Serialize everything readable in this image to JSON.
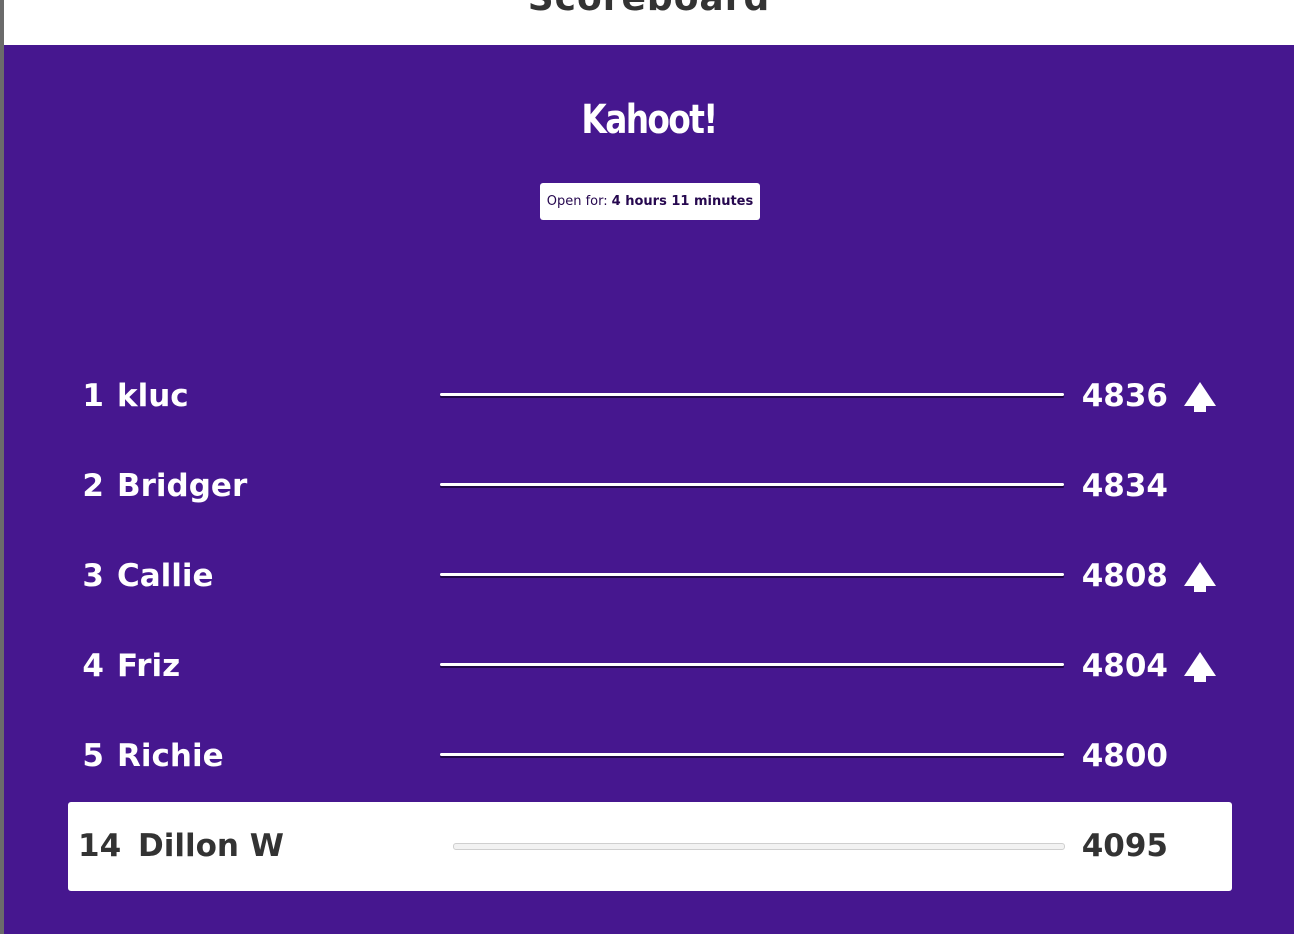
{
  "page": {
    "heading": "Scoreboard"
  },
  "logo": {
    "text": "Kahoot!"
  },
  "open_badge": {
    "label": "Open for:",
    "duration": "4 hours 11 minutes"
  },
  "leaderboard": [
    {
      "rank": "1",
      "name": "kluc",
      "score": "4836",
      "trend": "up-arrow-icon"
    },
    {
      "rank": "2",
      "name": "Bridger",
      "score": "4834",
      "trend": ""
    },
    {
      "rank": "3",
      "name": "Callie",
      "score": "4808",
      "trend": "up-arrow-icon"
    },
    {
      "rank": "4",
      "name": "Friz",
      "score": "4804",
      "trend": "up-arrow-icon"
    },
    {
      "rank": "5",
      "name": "Richie",
      "score": "4800",
      "trend": ""
    }
  ],
  "current_player": {
    "rank": "14",
    "name": "Dillon W",
    "score": "4095"
  },
  "colors": {
    "board_background": "#46178f",
    "text_light": "#ffffff",
    "text_dark": "#333333"
  }
}
